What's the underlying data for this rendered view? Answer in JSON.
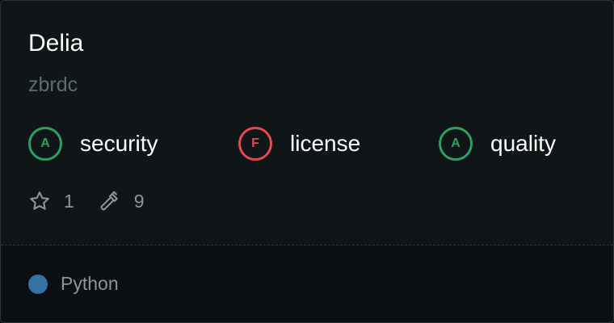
{
  "repo": {
    "name": "Delia",
    "owner": "zbrdc"
  },
  "grades": [
    {
      "letter": "A",
      "label": "security",
      "status": "good"
    },
    {
      "letter": "F",
      "label": "license",
      "status": "bad"
    },
    {
      "letter": "A",
      "label": "quality",
      "status": "good"
    }
  ],
  "stats": {
    "stars": "1",
    "forks": "9"
  },
  "language": {
    "name": "Python",
    "color": "#3572a5"
  },
  "colors": {
    "good": "#2f9e62",
    "bad": "#e5484d",
    "background": "#101518"
  },
  "icons": {
    "stars": "star-icon",
    "forks": "hammer-icon"
  }
}
